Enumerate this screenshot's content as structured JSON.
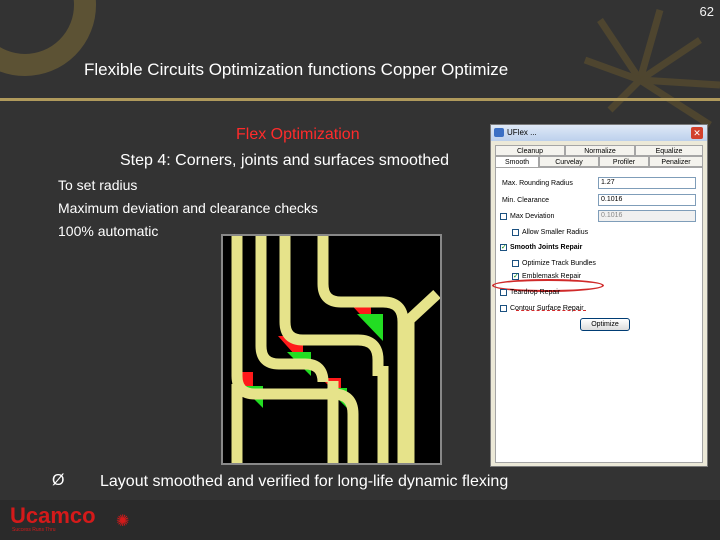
{
  "slide": {
    "page_number": "62",
    "title": "Flexible Circuits Optimization functions Copper Optimize",
    "subtitle_red": "Flex Optimization",
    "step": "Step 4: Corners, joints and surfaces smoothed",
    "bullets": [
      "To set radius",
      "Maximum deviation and clearance checks",
      "100% automatic"
    ],
    "footer_bullet_glyph": "Ø",
    "footer_text": "Layout smoothed and verified for long-life dynamic flexing",
    "logo": {
      "name": "Ucamco",
      "tagline": "Success Runs Thru"
    },
    "colors": {
      "background": "#333333",
      "accent_red": "#ff2b2b",
      "rule": "#b09a5c"
    }
  },
  "dialog": {
    "title": "UFlex ...",
    "close_glyph": "✕",
    "tabs_row1": [
      "Cleanup",
      "Normalize",
      "Equalize"
    ],
    "tabs_row2": [
      "Smooth",
      "Curvelay",
      "Profiler",
      "Penalizer"
    ],
    "active_tab": "Smooth",
    "fields": [
      {
        "label": "Max. Rounding Radius",
        "value": "1.27",
        "checkbox": false,
        "enabled": true
      },
      {
        "label": "Min. Clearance",
        "value": "0.1016",
        "checkbox": false,
        "enabled": true
      },
      {
        "label": "Max Deviation",
        "value": "0.1016",
        "checkbox": true,
        "checked": false,
        "enabled": false
      }
    ],
    "options": [
      {
        "label": "Allow Smaller Radius",
        "checked": false,
        "indent": true
      },
      {
        "label": "Smooth Joints Repair",
        "checked": true,
        "indent": false,
        "highlight": true
      },
      {
        "label": "Optimize Track Bundles",
        "checked": false,
        "indent": true
      },
      {
        "label": "Emblemask Repair",
        "checked": true,
        "indent": true
      },
      {
        "label": "Teardrop Repair",
        "checked": false,
        "indent": false
      },
      {
        "label": "Contour Surface Repair",
        "checked": false,
        "indent": false
      }
    ],
    "optimize_label": "Optimize",
    "check_glyph": "✓"
  }
}
